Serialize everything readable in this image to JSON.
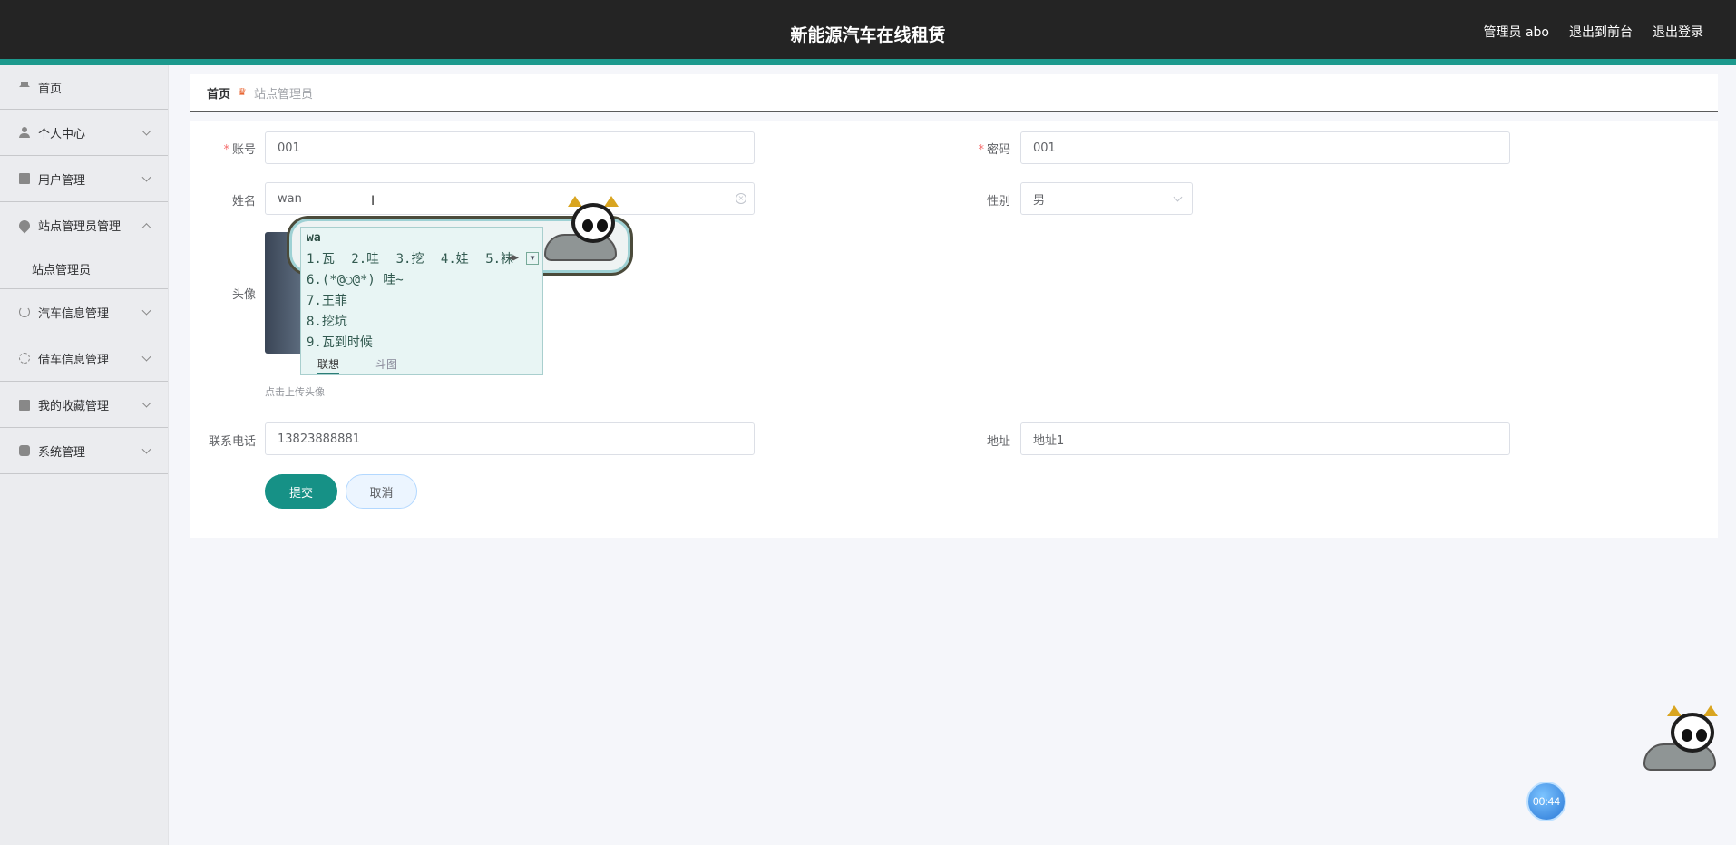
{
  "header": {
    "title": "新能源汽车在线租赁",
    "user_label": "管理员 abo",
    "front_link": "退出到前台",
    "logout_link": "退出登录"
  },
  "sidebar": {
    "items": [
      {
        "label": "首页",
        "icon": "home-icon"
      },
      {
        "label": "个人中心",
        "icon": "user-icon"
      },
      {
        "label": "用户管理",
        "icon": "clipboard-icon"
      },
      {
        "label": "站点管理员管理",
        "icon": "pin-icon",
        "expanded": true
      },
      {
        "label": "汽车信息管理",
        "icon": "power-icon"
      },
      {
        "label": "借车信息管理",
        "icon": "dial-icon"
      },
      {
        "label": "我的收藏管理",
        "icon": "bag-icon"
      },
      {
        "label": "系统管理",
        "icon": "thermometer-icon"
      }
    ],
    "subitems": {
      "station_admin": "站点管理员"
    }
  },
  "breadcrumb": {
    "home": "首页",
    "current": "站点管理员"
  },
  "form": {
    "account_label": "账号",
    "account_value": "001",
    "password_label": "密码",
    "password_value": "001",
    "name_label": "姓名",
    "name_value": "wan",
    "gender_label": "性别",
    "gender_value": "男",
    "avatar_label": "头像",
    "avatar_hint": "点击上传头像",
    "phone_label": "联系电话",
    "phone_value": "13823888881",
    "address_label": "地址",
    "address_value": "地址1",
    "submit_label": "提交",
    "cancel_label": "取消"
  },
  "ime": {
    "composition": "wa",
    "row1": [
      "1.瓦",
      "2.哇",
      "3.挖",
      "4.娃",
      "5.袜"
    ],
    "row2": "6.(*@○@*) 哇~",
    "row3": "7.王菲",
    "row4": "8.挖坑",
    "row5": "9.瓦到时候",
    "tab_suggest": "联想",
    "tab_sticker": "斗图"
  },
  "timer": "00:44",
  "colors": {
    "topbar": "#242424",
    "accent": "#1c998d",
    "primary_button": "#169186",
    "required": "#f56c6c"
  }
}
